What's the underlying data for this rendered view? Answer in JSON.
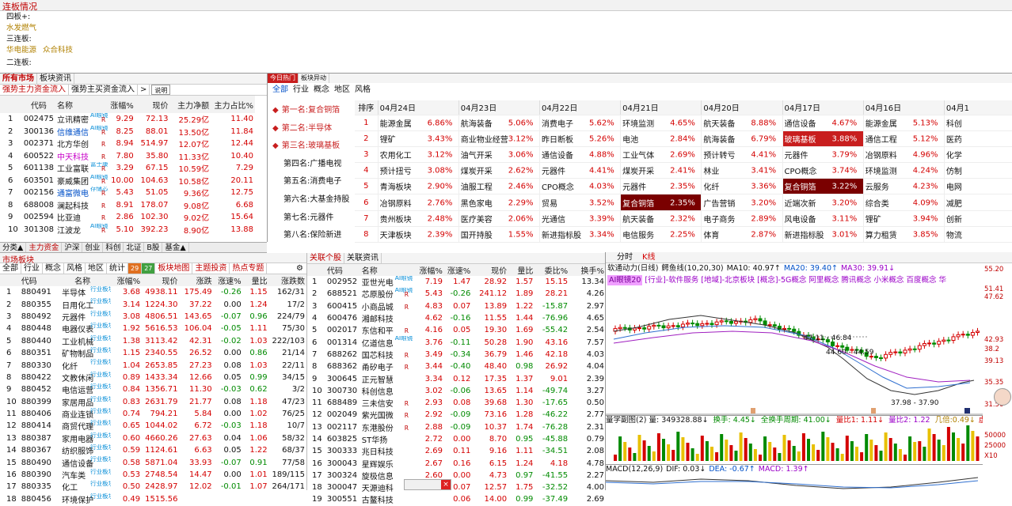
{
  "top": {
    "title": "连板情况",
    "rows": [
      {
        "label": "四板+:",
        "items": []
      },
      {
        "label": "",
        "items": [
          "水发燃气"
        ]
      },
      {
        "label": "三连板:",
        "items": []
      },
      {
        "label": "",
        "items": [
          "华电能源",
          "众合科技"
        ]
      },
      {
        "label": "二连板:",
        "items": []
      }
    ]
  },
  "left": {
    "tabs1": [
      "所有市场",
      "板块资讯"
    ],
    "tabs2": [
      "强势主力资金流入",
      "强势主买资金流入",
      ">",
      "说明"
    ],
    "headers": [
      "代码",
      "名称",
      "涨幅%",
      "现价",
      "主力净额",
      "主力占比%"
    ],
    "rows": [
      {
        "no": "1",
        "code": "002475",
        "name": "立讯精密",
        "tag": "AI眼镜",
        "chg": "9.29",
        "price": "72.13",
        "net": "25.29亿",
        "pct": "11.40"
      },
      {
        "no": "2",
        "code": "300136",
        "name": "信维通信",
        "tag": "AI眼镜",
        "chg": "8.25",
        "price": "88.01",
        "net": "13.50亿",
        "pct": "11.84"
      },
      {
        "no": "3",
        "code": "002371",
        "name": "北方华创",
        "tag": "",
        "chg": "8.94",
        "price": "514.97",
        "net": "12.07亿",
        "pct": "12.44"
      },
      {
        "no": "4",
        "code": "600522",
        "name": "中天科技",
        "tag": "",
        "chg": "7.80",
        "price": "35.80",
        "net": "11.33亿",
        "pct": "10.40"
      },
      {
        "no": "5",
        "code": "601138",
        "name": "工业富联",
        "tag": "富士康",
        "chg": "3.29",
        "price": "67.15",
        "net": "10.59亿",
        "pct": "7.29"
      },
      {
        "no": "6",
        "code": "603501",
        "name": "豪威集团",
        "tag": "AI眼镜",
        "chg": "10.00",
        "price": "104.63",
        "net": "10.58亿",
        "pct": "20.11"
      },
      {
        "no": "7",
        "code": "002156",
        "name": "通富微电",
        "tag": "存储芯片",
        "chg": "5.43",
        "price": "51.05",
        "net": "9.36亿",
        "pct": "12.75"
      },
      {
        "no": "8",
        "code": "688008",
        "name": "澜起科技",
        "tag": "",
        "chg": "8.91",
        "price": "178.07",
        "net": "9.08亿",
        "pct": "6.68"
      },
      {
        "no": "9",
        "code": "002594",
        "name": "比亚迪",
        "tag": "",
        "chg": "2.86",
        "price": "102.30",
        "net": "9.02亿",
        "pct": "15.64"
      },
      {
        "no": "10",
        "code": "301308",
        "name": "江波龙",
        "tag": "AI眼镜",
        "chg": "5.10",
        "price": "392.23",
        "net": "8.90亿",
        "pct": "13.88"
      }
    ]
  },
  "hot": {
    "tabs1": [
      "今日热门",
      "板块异动"
    ],
    "tabs2": [
      "全部",
      "行业",
      "概念",
      "地区",
      "风格"
    ],
    "ranks": [
      "第一名:复合铜箔",
      "第二名:半导体",
      "第三名:玻璃基板",
      "第四名:广播电视",
      "第五名:消费电子",
      "第六名:大基金持股",
      "第七名:元器件",
      "第八名:保险新进"
    ],
    "rankhead": "排序",
    "dates": [
      "04月24日",
      "04月23日",
      "04月22日",
      "04月21日",
      "04月20日",
      "04月17日",
      "04月16日",
      "04月1"
    ],
    "rows": [
      {
        "n": "1",
        "c": [
          [
            "能源金属",
            "6.86%"
          ],
          [
            "航海装备",
            "5.06%"
          ],
          [
            "消费电子",
            "5.62%"
          ],
          [
            "环境监测",
            "4.65%"
          ],
          [
            "航天装备",
            "8.88%"
          ],
          [
            "通信设备",
            "4.67%"
          ],
          [
            "能源金属",
            "5.13%"
          ],
          [
            "科创",
            ""
          ]
        ]
      },
      {
        "n": "2",
        "c": [
          [
            "锂矿",
            "3.43%"
          ],
          [
            "商业物业经营",
            "3.12%"
          ],
          [
            "昨日断板",
            "5.26%"
          ],
          [
            "电池",
            "2.84%"
          ],
          [
            "航海装备",
            "6.79%"
          ],
          [
            "玻璃基板",
            "3.88%"
          ],
          [
            "通信工程",
            "5.12%"
          ],
          [
            "医药",
            ""
          ]
        ]
      },
      {
        "n": "3",
        "c": [
          [
            "农用化工",
            "3.12%"
          ],
          [
            "油气开采",
            "3.06%"
          ],
          [
            "通信设备",
            "4.88%"
          ],
          [
            "工业气体",
            "2.69%"
          ],
          [
            "预计转亏",
            "4.41%"
          ],
          [
            "元器件",
            "3.79%"
          ],
          [
            "冶钢原料",
            "4.96%"
          ],
          [
            "化学",
            ""
          ]
        ]
      },
      {
        "n": "4",
        "c": [
          [
            "预计扭亏",
            "3.08%"
          ],
          [
            "煤炭开采",
            "2.62%"
          ],
          [
            "元器件",
            "4.41%"
          ],
          [
            "煤炭开采",
            "2.41%"
          ],
          [
            "林业",
            "3.41%"
          ],
          [
            "CPO概念",
            "3.74%"
          ],
          [
            "环境监测",
            "4.24%"
          ],
          [
            "仿制",
            ""
          ]
        ]
      },
      {
        "n": "5",
        "c": [
          [
            "青海板块",
            "2.90%"
          ],
          [
            "油服工程",
            "2.46%"
          ],
          [
            "CPO概念",
            "4.03%"
          ],
          [
            "元器件",
            "2.35%"
          ],
          [
            "化纤",
            "3.36%"
          ],
          [
            "复合铜箔",
            "3.22%"
          ],
          [
            "云服务",
            "4.23%"
          ],
          [
            "电网",
            ""
          ]
        ]
      },
      {
        "n": "6",
        "c": [
          [
            "冶钢原料",
            "2.76%"
          ],
          [
            "黑色家电",
            "2.29%"
          ],
          [
            "贸易",
            "3.52%"
          ],
          [
            "复合铜箔",
            "2.35%"
          ],
          [
            "广告营销",
            "3.20%"
          ],
          [
            "近端次新",
            "3.20%"
          ],
          [
            "综合类",
            "4.09%"
          ],
          [
            "减肥",
            ""
          ]
        ]
      },
      {
        "n": "7",
        "c": [
          [
            "贵州板块",
            "2.48%"
          ],
          [
            "医疗美容",
            "2.06%"
          ],
          [
            "光通信",
            "3.39%"
          ],
          [
            "航天装备",
            "2.32%"
          ],
          [
            "电子商务",
            "2.89%"
          ],
          [
            "风电设备",
            "3.11%"
          ],
          [
            "锂矿",
            "3.94%"
          ],
          [
            "创新",
            ""
          ]
        ]
      },
      {
        "n": "8",
        "c": [
          [
            "天津板块",
            "2.39%"
          ],
          [
            "国开持股",
            "1.55%"
          ],
          [
            "新进指标股",
            "3.34%"
          ],
          [
            "电信服务",
            "2.25%"
          ],
          [
            "体育",
            "2.87%"
          ],
          [
            "新进指标股",
            "3.01%"
          ],
          [
            "算力租赁",
            "3.85%"
          ],
          [
            "物流",
            ""
          ]
        ]
      }
    ]
  },
  "midtabs": [
    "分类▲",
    "主力资金",
    "沪深",
    "创业",
    "科创",
    "北证",
    "B股",
    "基金▲"
  ],
  "market": {
    "title": "市场板块",
    "tabs": [
      "全部",
      "行业",
      "概念",
      "风格",
      "地区",
      "统计",
      "29",
      "27",
      "板块地图",
      "主题投资",
      "热点专题"
    ],
    "headers": [
      "代码",
      "名称",
      "涨幅%",
      "现价",
      "涨跌",
      "涨速%",
      "量比",
      "涨跌数"
    ],
    "tagtext": "行业板块",
    "rows": [
      {
        "n": "1",
        "code": "880491",
        "name": "半导体",
        "chg": "3.68",
        "price": "4938.11",
        "diff": "175.49",
        "spd": "-0.26",
        "vr": "1.15",
        "ud": "162/31"
      },
      {
        "n": "2",
        "code": "880355",
        "name": "日用化工",
        "chg": "3.14",
        "price": "1224.30",
        "diff": "37.22",
        "spd": "0.00",
        "vr": "1.24",
        "ud": "17/2"
      },
      {
        "n": "3",
        "code": "880492",
        "name": "元器件",
        "chg": "3.08",
        "price": "4806.51",
        "diff": "143.65",
        "spd": "-0.07",
        "vr": "0.96",
        "ud": "224/79"
      },
      {
        "n": "4",
        "code": "880448",
        "name": "电器仪表",
        "chg": "1.92",
        "price": "5616.53",
        "diff": "106.04",
        "spd": "-0.05",
        "vr": "1.11",
        "ud": "75/30"
      },
      {
        "n": "5",
        "code": "880440",
        "name": "工业机械",
        "chg": "1.38",
        "price": "3113.42",
        "diff": "42.31",
        "spd": "-0.02",
        "vr": "1.03",
        "ud": "222/103"
      },
      {
        "n": "6",
        "code": "880351",
        "name": "矿物制品",
        "chg": "1.15",
        "price": "2340.55",
        "diff": "26.52",
        "spd": "0.00",
        "vr": "0.86",
        "ud": "21/14"
      },
      {
        "n": "7",
        "code": "880330",
        "name": "化纤",
        "chg": "1.04",
        "price": "2653.85",
        "diff": "27.23",
        "spd": "0.08",
        "vr": "1.03",
        "ud": "22/11"
      },
      {
        "n": "8",
        "code": "880422",
        "name": "文教休闲",
        "chg": "0.89",
        "price": "1433.34",
        "diff": "12.66",
        "spd": "0.05",
        "vr": "0.99",
        "ud": "34/15"
      },
      {
        "n": "9",
        "code": "880452",
        "name": "电信运营",
        "chg": "0.84",
        "price": "1356.71",
        "diff": "11.30",
        "spd": "-0.03",
        "vr": "0.62",
        "ud": "3/2"
      },
      {
        "n": "10",
        "code": "880399",
        "name": "家居用品",
        "chg": "0.83",
        "price": "2631.79",
        "diff": "21.77",
        "spd": "0.08",
        "vr": "1.18",
        "ud": "47/23"
      },
      {
        "n": "11",
        "code": "880406",
        "name": "商业连锁",
        "chg": "0.74",
        "price": "794.21",
        "diff": "5.84",
        "spd": "0.00",
        "vr": "1.02",
        "ud": "76/25"
      },
      {
        "n": "12",
        "code": "880414",
        "name": "商贸代理",
        "chg": "0.65",
        "price": "1044.02",
        "diff": "6.72",
        "spd": "-0.03",
        "vr": "1.18",
        "ud": "10/7"
      },
      {
        "n": "13",
        "code": "880387",
        "name": "家用电器",
        "chg": "0.60",
        "price": "4660.26",
        "diff": "27.63",
        "spd": "0.04",
        "vr": "1.06",
        "ud": "58/32"
      },
      {
        "n": "14",
        "code": "880367",
        "name": "纺织服饰",
        "chg": "0.59",
        "price": "1124.61",
        "diff": "6.63",
        "spd": "0.05",
        "vr": "1.22",
        "ud": "68/37"
      },
      {
        "n": "15",
        "code": "880490",
        "name": "通信设备",
        "chg": "0.58",
        "price": "5871.04",
        "diff": "33.93",
        "spd": "-0.07",
        "vr": "0.91",
        "ud": "77/58"
      },
      {
        "n": "16",
        "code": "880390",
        "name": "汽车类",
        "chg": "0.53",
        "price": "2748.54",
        "diff": "14.47",
        "spd": "0.00",
        "vr": "1.01",
        "ud": "189/115"
      },
      {
        "n": "17",
        "code": "880335",
        "name": "化工",
        "chg": "0.50",
        "price": "2428.97",
        "diff": "12.02",
        "spd": "-0.01",
        "vr": "1.07",
        "ud": "264/171"
      },
      {
        "n": "18",
        "code": "880456",
        "name": "环境保护",
        "chg": "0.49",
        "price": "1515.56",
        "diff": "",
        "spd": "",
        "vr": "",
        "ud": ""
      }
    ]
  },
  "linked": {
    "tabs": [
      "关联个股",
      "关联资讯"
    ],
    "headers": [
      "代码",
      "名称",
      "涨幅%",
      "涨速%",
      "现价",
      "量比",
      "委比%",
      "换手%"
    ],
    "rows": [
      {
        "n": "1",
        "code": "002952",
        "name": "亚世光电",
        "tag": "AI眼镜",
        "r": "",
        "chg": "7.19",
        "spd": "1.47",
        "price": "28.92",
        "vr": "1.57",
        "wb": "15.15",
        "hs": "13.34"
      },
      {
        "n": "2",
        "code": "688521",
        "name": "芯原股份",
        "tag": "AI眼镜",
        "r": "R",
        "chg": "5.43",
        "spd": "-0.26",
        "price": "241.12",
        "vr": "1.89",
        "wb": "28.21",
        "hs": "4.26"
      },
      {
        "n": "3",
        "code": "600415",
        "name": "小商品城",
        "tag": "",
        "r": "R",
        "chg": "4.83",
        "spd": "0.07",
        "price": "13.89",
        "vr": "1.22",
        "wb": "-15.87",
        "hs": "2.97"
      },
      {
        "n": "4",
        "code": "600476",
        "name": "湘邮科技",
        "tag": "",
        "r": "",
        "chg": "4.62",
        "spd": "-0.16",
        "price": "11.55",
        "vr": "1.44",
        "wb": "-76.96",
        "hs": "4.65"
      },
      {
        "n": "5",
        "code": "002017",
        "name": "东信和平",
        "tag": "",
        "r": "R",
        "chg": "4.16",
        "spd": "0.05",
        "price": "19.30",
        "vr": "1.69",
        "wb": "-55.42",
        "hs": "2.54"
      },
      {
        "n": "6",
        "code": "001314",
        "name": "亿道信息",
        "tag": "AI眼镜",
        "r": "",
        "chg": "3.76",
        "spd": "-0.11",
        "price": "50.28",
        "vr": "1.90",
        "wb": "43.16",
        "hs": "7.57"
      },
      {
        "n": "7",
        "code": "688262",
        "name": "国芯科技",
        "tag": "",
        "r": "R",
        "chg": "3.49",
        "spd": "-0.34",
        "price": "36.79",
        "vr": "1.46",
        "wb": "42.18",
        "hs": "4.03"
      },
      {
        "n": "8",
        "code": "688362",
        "name": "甬矽电子",
        "tag": "",
        "r": "R",
        "chg": "3.44",
        "spd": "-0.40",
        "price": "48.40",
        "vr": "0.98",
        "wb": "26.92",
        "hs": "4.04"
      },
      {
        "n": "9",
        "code": "300645",
        "name": "正元智慧",
        "tag": "",
        "r": "",
        "chg": "3.34",
        "spd": "0.12",
        "price": "17.35",
        "vr": "1.37",
        "wb": "9.01",
        "hs": "2.39"
      },
      {
        "n": "10",
        "code": "300730",
        "name": "科创信息",
        "tag": "",
        "r": "",
        "chg": "3.02",
        "spd": "-0.06",
        "price": "13.65",
        "vr": "1.14",
        "wb": "-49.74",
        "hs": "3.27"
      },
      {
        "n": "11",
        "code": "688489",
        "name": "三未信安",
        "tag": "",
        "r": "R",
        "chg": "2.93",
        "spd": "0.08",
        "price": "39.68",
        "vr": "1.30",
        "wb": "-17.65",
        "hs": "0.50"
      },
      {
        "n": "12",
        "code": "002049",
        "name": "紫光国微",
        "tag": "",
        "r": "R",
        "chg": "2.92",
        "spd": "-0.09",
        "price": "73.16",
        "vr": "1.28",
        "wb": "-46.22",
        "hs": "2.77"
      },
      {
        "n": "13",
        "code": "002117",
        "name": "东港股份",
        "tag": "",
        "r": "R",
        "chg": "2.88",
        "spd": "-0.09",
        "price": "10.37",
        "vr": "1.74",
        "wb": "-76.28",
        "hs": "2.31"
      },
      {
        "n": "14",
        "code": "603825",
        "name": "ST华扬",
        "tag": "",
        "r": "",
        "chg": "2.72",
        "spd": "0.00",
        "price": "8.70",
        "vr": "0.95",
        "wb": "-45.88",
        "hs": "0.79"
      },
      {
        "n": "15",
        "code": "300333",
        "name": "兆日科技",
        "tag": "",
        "r": "",
        "chg": "2.69",
        "spd": "0.11",
        "price": "9.16",
        "vr": "1.11",
        "wb": "-34.51",
        "hs": "2.08"
      },
      {
        "n": "16",
        "code": "300043",
        "name": "星辉娱乐",
        "tag": "",
        "r": "",
        "chg": "2.67",
        "spd": "0.16",
        "price": "6.15",
        "vr": "1.24",
        "wb": "4.18",
        "hs": "4.78"
      },
      {
        "n": "17",
        "code": "300324",
        "name": "旋极信息",
        "tag": "",
        "r": "",
        "chg": "2.60",
        "spd": "0.00",
        "price": "4.73",
        "vr": "0.97",
        "wb": "-41.55",
        "hs": "2.27"
      },
      {
        "n": "18",
        "code": "300047",
        "name": "天源迪科",
        "tag": "",
        "r": "R",
        "chg": "2.57",
        "spd": "0.07",
        "price": "12.57",
        "vr": "1.75",
        "wb": "-32.52",
        "hs": "4.00"
      },
      {
        "n": "19",
        "code": "300551",
        "name": "古鳌科技",
        "tag": "",
        "r": "",
        "chg": "",
        "spd": "0.06",
        "price": "14.00",
        "vr": "0.99",
        "wb": "-37.49",
        "hs": "2.69"
      }
    ]
  },
  "kline": {
    "tabs": [
      "分时",
      "K线"
    ],
    "header_text": "软通动力(日线)",
    "ma": {
      "label": "鳄鱼线(10,20,30)",
      "ma10": "MA10: 40.97↑",
      "ma20": "MA20: 39.40↑",
      "ma30": "MA30: 39.91↓"
    },
    "info": "[行业]-软件服务 [地域]-北京板块 [概念]-5G概念 阿里概念 腾讯概念 小米概念 百度概念 华",
    "badge": "AI眼镜20",
    "prices": [
      "55.20",
      "51.41",
      "47.62",
      "42.93",
      "38.2",
      "39.13",
      "35.35",
      "31.56"
    ],
    "anno1": "47.11 - 46.84",
    "anno2": "44.60 - 44.59",
    "anno3": "37.98 - 37.90",
    "vol": {
      "label": "量学副图(2) 量: 349328.88↓",
      "hs": "换手: 4.45↓",
      "hsp": "全换手周期: 41.00↓",
      "lb1": "量比1: 1.11↓",
      "lb2": "量比2: 1.22",
      "jx": "几倍:0.49↓",
      "xj": "虚几",
      "axis": [
        "50000",
        "25000",
        "X10"
      ]
    },
    "macd": {
      "label": "MACD(12,26,9)",
      "dif": "DIF: 0.03↓",
      "dea": "DEA: -0.67↑",
      "macd": "MACD: 1.39↑"
    }
  },
  "colors": {
    "red": "#d40000",
    "green": "#008a00",
    "hotred": "#c81e1e",
    "darkred": "#7a0000"
  }
}
